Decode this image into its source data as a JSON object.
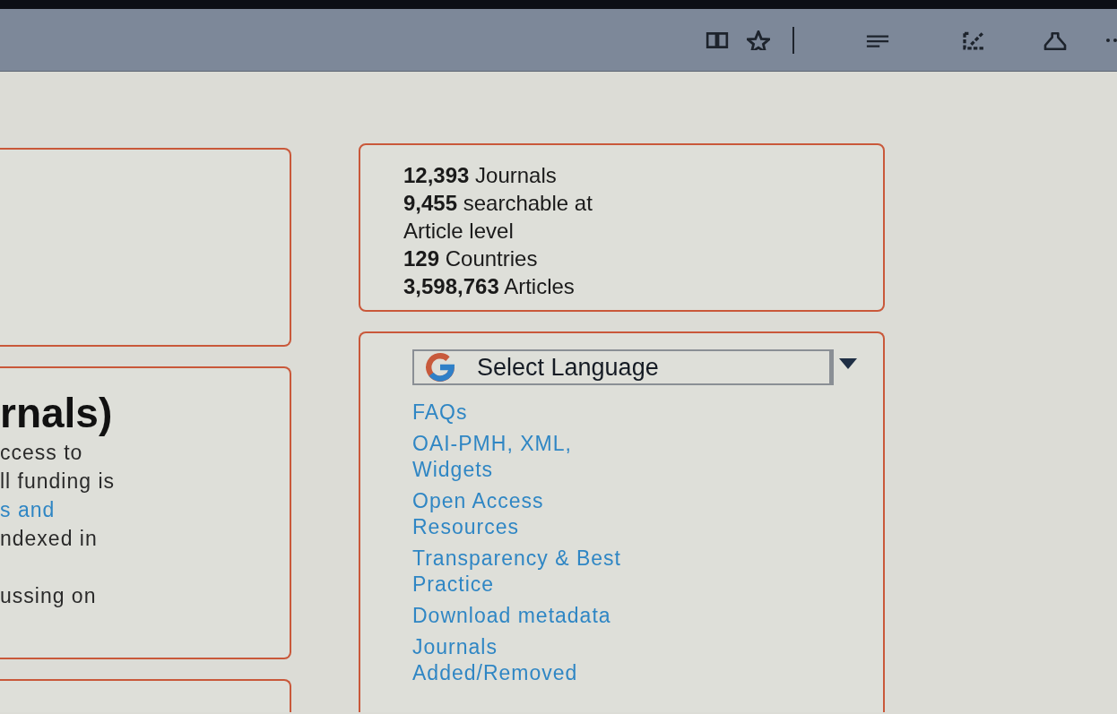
{
  "left_cards": [
    {
      "kind": "empty"
    },
    {
      "kind": "text",
      "heading": "rnals)",
      "lines": [
        {
          "text": "ccess to",
          "kind": "plain"
        },
        {
          "text": "ll funding is",
          "kind": "plain"
        },
        {
          "text": "s and",
          "kind": "link"
        },
        {
          "text": "ndexed in",
          "kind": "plain"
        },
        {
          "kind": "blank"
        },
        {
          "text": "ussing on",
          "kind": "plain"
        }
      ]
    },
    {
      "kind": "empty"
    }
  ],
  "stats": [
    {
      "lines": [
        "**12,393** Journals"
      ]
    },
    {
      "lines": [
        "**9,455** searchable at",
        "Article level"
      ]
    },
    {
      "lines": [
        "**129** Countries"
      ]
    },
    {
      "lines": [
        "**3,598,763** Articles"
      ]
    }
  ],
  "language_select": {
    "value": "Select Language"
  },
  "links": [
    {
      "lines": [
        "FAQs"
      ]
    },
    {
      "lines": [
        "OAI-PMH, XML,",
        "Widgets"
      ]
    },
    {
      "lines": [
        "Open Access",
        "Resources"
      ]
    },
    {
      "lines": [
        "Transparency & Best",
        "Practice"
      ]
    },
    {
      "lines": [
        "Download metadata"
      ]
    },
    {
      "lines": [
        "Journals",
        "Added/Removed"
      ]
    }
  ]
}
